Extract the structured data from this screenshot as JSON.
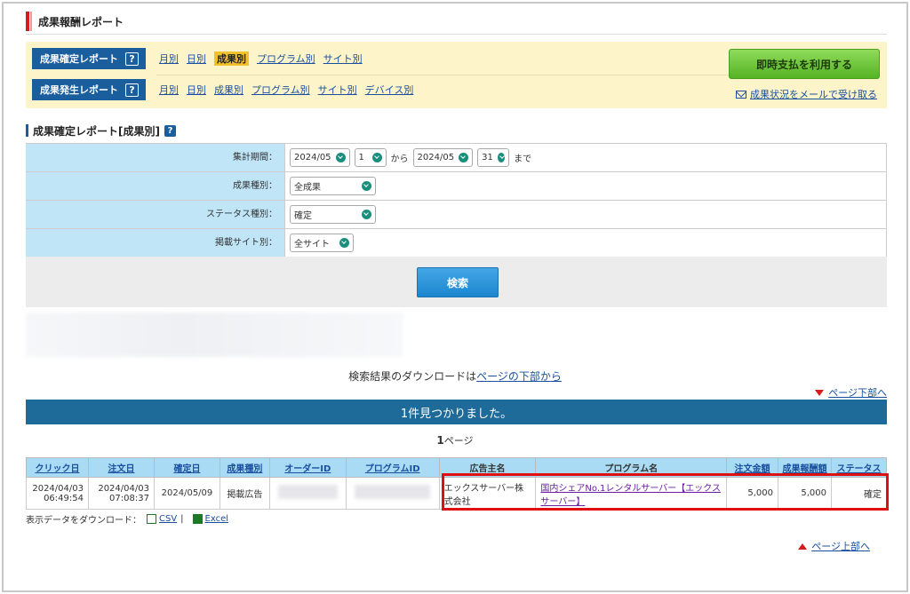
{
  "page": {
    "title": "成果報酬レポート"
  },
  "nav": {
    "confirmed_label": "成果確定レポート",
    "generated_label": "成果発生レポート",
    "help_glyph": "?",
    "confirmed_links": [
      "月別",
      "日別",
      "成果別",
      "プログラム別",
      "サイト別"
    ],
    "confirmed_active": "成果別",
    "generated_links": [
      "月別",
      "日別",
      "成果別",
      "プログラム別",
      "サイト別",
      "デバイス別"
    ],
    "pay_button": "即時支払を利用する",
    "mail_link": "成果状況をメールで受け取る"
  },
  "section": {
    "title": "成果確定レポート[成果別]",
    "help_glyph": "?"
  },
  "filter": {
    "period_label": "集計期間：",
    "period_from_month": "2024/05",
    "period_from_day": "1",
    "from_text": "から",
    "period_to_month": "2024/05",
    "period_to_day": "31",
    "to_text": "まで",
    "type_label": "成果種別：",
    "type_value": "全成果",
    "status_label": "ステータス種別：",
    "status_value": "確定",
    "site_label": "掲載サイト別：",
    "site_value": "全サイト",
    "search_button": "検索"
  },
  "results": {
    "download_note_prefix": "検索結果のダウンロードは",
    "download_note_link": "ページの下部から",
    "page_bottom_link": "ページ下部へ",
    "banner": "1件見つかりました。",
    "page_num": "1",
    "page_suffix": "ページ",
    "headers": [
      "クリック日",
      "注文日",
      "確定日",
      "成果種別",
      "オーダーID",
      "プログラムID",
      "広告主名",
      "プログラム名",
      "注文金額",
      "成果報酬額",
      "ステータス"
    ],
    "row": {
      "click_date": "2024/04/03",
      "click_time": "06:49:54",
      "order_date": "2024/04/03",
      "order_time": "07:08:37",
      "confirm_date": "2024/05/09",
      "type": "掲載広告",
      "advertiser": "エックスサーバー株式会社",
      "program": "国内シェアNo.1レンタルサーバー【エックスサーバー】",
      "order_amount": "5,000",
      "reward": "5,000",
      "status": "確定"
    },
    "download_label": "表示データをダウンロード：",
    "csv": "CSV",
    "separator": "|",
    "excel": "Excel",
    "page_top_link": "ページ上部へ"
  },
  "colors": {
    "accent_red": "#d81c1c",
    "nav_blue": "#1a5e9e",
    "banner_blue": "#1e6b9a",
    "pay_green": "#55b324",
    "highlight": "#e01010"
  }
}
